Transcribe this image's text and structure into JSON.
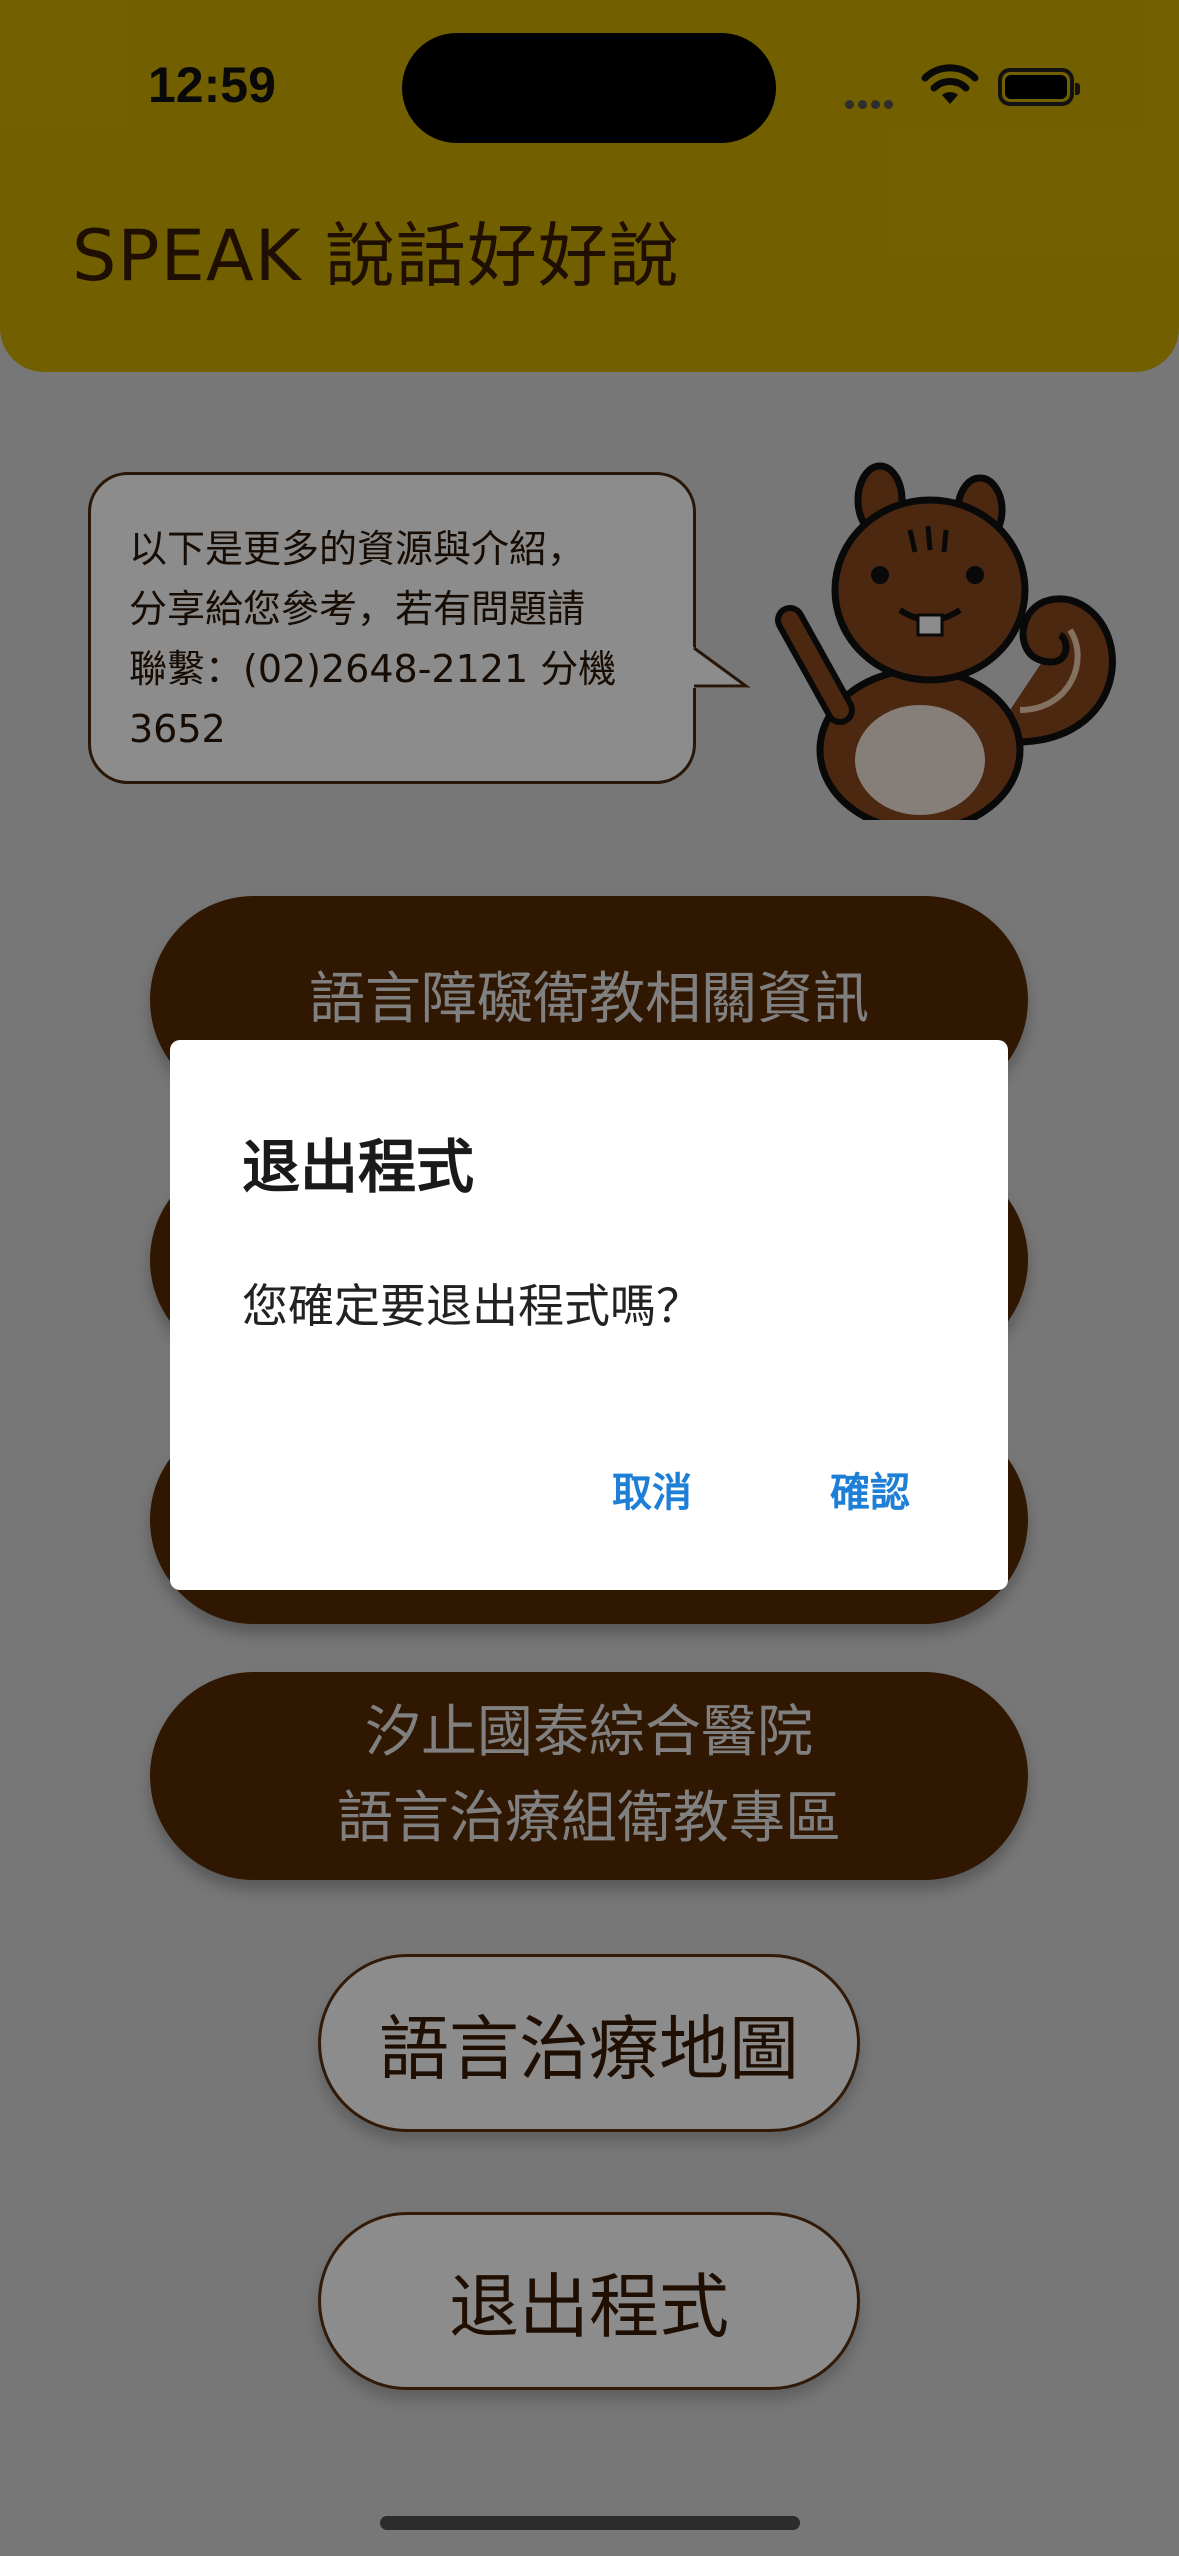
{
  "status_bar": {
    "time": "12:59"
  },
  "header": {
    "title": "SPEAK 說話好好說"
  },
  "speech_bubble": {
    "lines": [
      "以下是更多的資源與介紹，",
      "分享給您參考，若有問題請",
      "聯繫：(02)2648-2121 分機",
      "3652"
    ]
  },
  "menu": {
    "info_button": "語言障礙衛教相關資訊",
    "hospital_button_line1": "汐止國泰綜合醫院",
    "hospital_button_line2": "語言治療組衛教專區",
    "map_button": "語言治療地圖",
    "exit_button": "退出程式"
  },
  "dialog": {
    "title": "退出程式",
    "message": "您確定要退出程式嗎？",
    "cancel_label": "取消",
    "confirm_label": "確認"
  },
  "colors": {
    "header": "#d0b000",
    "button_brown": "#582a05",
    "dialog_action": "#1e7fd6"
  }
}
